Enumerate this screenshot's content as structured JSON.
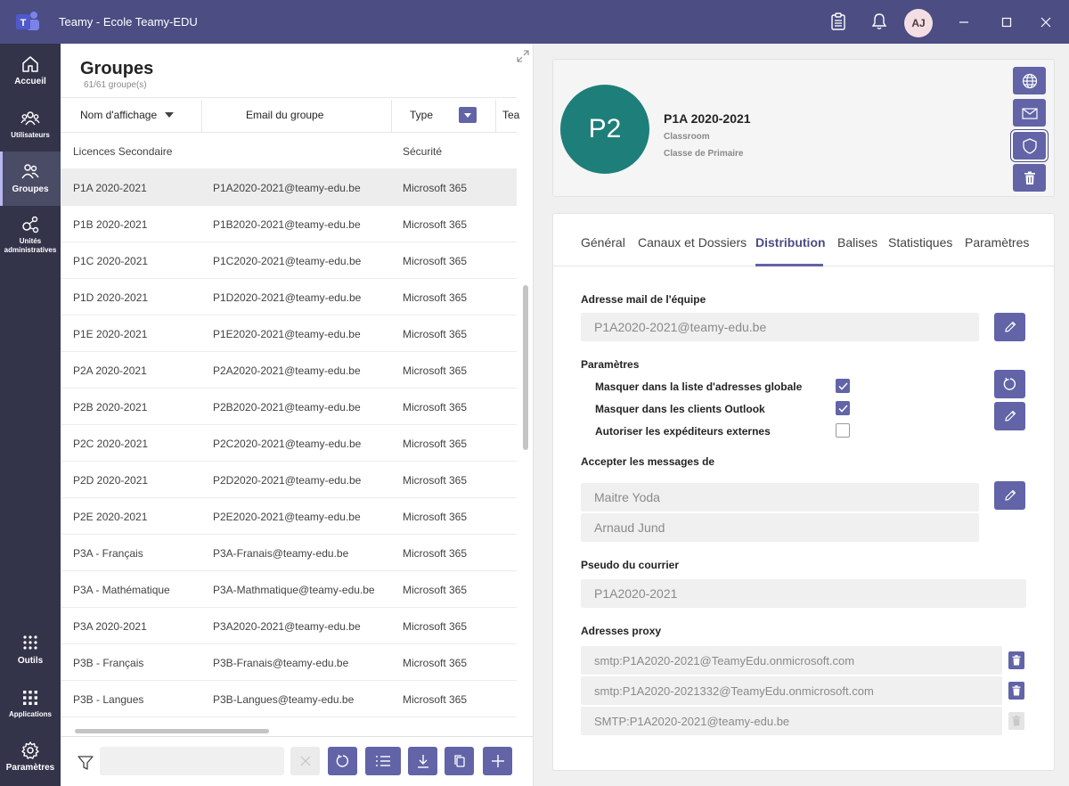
{
  "app": {
    "title": "Teamy - Ecole Teamy-EDU",
    "avatar_initials": "AJ",
    "accent": "#6264a7",
    "titlebar_color": "#4b4d83",
    "rail_color": "#33344a"
  },
  "titlebar_icons": [
    "clipboard-icon",
    "bell-icon",
    "minimize-icon",
    "maximize-icon",
    "close-icon"
  ],
  "rail": {
    "items": [
      {
        "label": "Accueil",
        "icon": "home-icon"
      },
      {
        "label": "Utilisateurs",
        "icon": "users-icon"
      },
      {
        "label": "Groupes",
        "icon": "groups-icon",
        "active": true
      },
      {
        "label": "Unités administratives",
        "icon": "admin-units-icon"
      },
      {
        "label": "Outils",
        "icon": "grid-icon"
      },
      {
        "label": "Applications",
        "icon": "apps-icon"
      },
      {
        "label": "Paramètres",
        "icon": "gear-icon"
      }
    ]
  },
  "groups": {
    "title": "Groupes",
    "count": "61/61 groupe(s)",
    "columns": {
      "name": "Nom d'affichage",
      "email": "Email du groupe",
      "type": "Type",
      "team": "Tea"
    },
    "rows": [
      {
        "name": "Licences Secondaire",
        "email": "",
        "type": "Sécurité"
      },
      {
        "name": "P1A 2020-2021",
        "email": "P1A2020-2021@teamy-edu.be",
        "type": "Microsoft 365",
        "selected": true
      },
      {
        "name": "P1B 2020-2021",
        "email": "P1B2020-2021@teamy-edu.be",
        "type": "Microsoft 365"
      },
      {
        "name": "P1C 2020-2021",
        "email": "P1C2020-2021@teamy-edu.be",
        "type": "Microsoft 365"
      },
      {
        "name": "P1D 2020-2021",
        "email": "P1D2020-2021@teamy-edu.be",
        "type": "Microsoft 365"
      },
      {
        "name": "P1E 2020-2021",
        "email": "P1E2020-2021@teamy-edu.be",
        "type": "Microsoft 365"
      },
      {
        "name": "P2A 2020-2021",
        "email": "P2A2020-2021@teamy-edu.be",
        "type": "Microsoft 365"
      },
      {
        "name": "P2B 2020-2021",
        "email": "P2B2020-2021@teamy-edu.be",
        "type": "Microsoft 365"
      },
      {
        "name": "P2C 2020-2021",
        "email": "P2C2020-2021@teamy-edu.be",
        "type": "Microsoft 365"
      },
      {
        "name": "P2D 2020-2021",
        "email": "P2D2020-2021@teamy-edu.be",
        "type": "Microsoft 365"
      },
      {
        "name": "P2E 2020-2021",
        "email": "P2E2020-2021@teamy-edu.be",
        "type": "Microsoft 365"
      },
      {
        "name": "P3A - Français",
        "email": "P3A-Franais@teamy-edu.be",
        "type": "Microsoft 365"
      },
      {
        "name": "P3A - Mathématique",
        "email": "P3A-Mathmatique@teamy-edu.be",
        "type": "Microsoft 365"
      },
      {
        "name": "P3A 2020-2021",
        "email": "P3A2020-2021@teamy-edu.be",
        "type": "Microsoft 365"
      },
      {
        "name": "P3B - Français",
        "email": "P3B-Franais@teamy-edu.be",
        "type": "Microsoft 365"
      },
      {
        "name": "P3B - Langues",
        "email": "P3B-Langues@teamy-edu.be",
        "type": "Microsoft 365"
      }
    ],
    "filter_placeholder": ""
  },
  "detail": {
    "initials": "P2",
    "name": "P1A 2020-2021",
    "kind": "Classroom",
    "subtitle": "Classe de Primaire",
    "tabs": [
      "Général",
      "Canaux et Dossiers",
      "Distribution",
      "Balises",
      "Statistiques",
      "Paramètres"
    ],
    "active_tab": "Distribution",
    "team_mail_label": "Adresse mail de l'équipe",
    "team_mail": "P1A2020-2021@teamy-edu.be",
    "settings_label": "Paramètres",
    "settings": [
      {
        "label": "Masquer dans la liste d'adresses globale",
        "checked": true
      },
      {
        "label": "Masquer dans les clients Outlook",
        "checked": true
      },
      {
        "label": "Autoriser les expéditeurs externes",
        "checked": false
      }
    ],
    "accept_label": "Accepter les messages de",
    "accept_from": [
      "Maitre Yoda",
      "Arnaud Jund"
    ],
    "alias_label": "Pseudo du courrier",
    "alias": "P1A2020-2021",
    "proxy_label": "Adresses proxy",
    "proxies": [
      {
        "value": "smtp:P1A2020-2021@TeamyEdu.onmicrosoft.com",
        "deletable": true
      },
      {
        "value": "smtp:P1A2020-2021332@TeamyEdu.onmicrosoft.com",
        "deletable": true
      },
      {
        "value": "SMTP:P1A2020-2021@teamy-edu.be",
        "deletable": false
      }
    ]
  }
}
